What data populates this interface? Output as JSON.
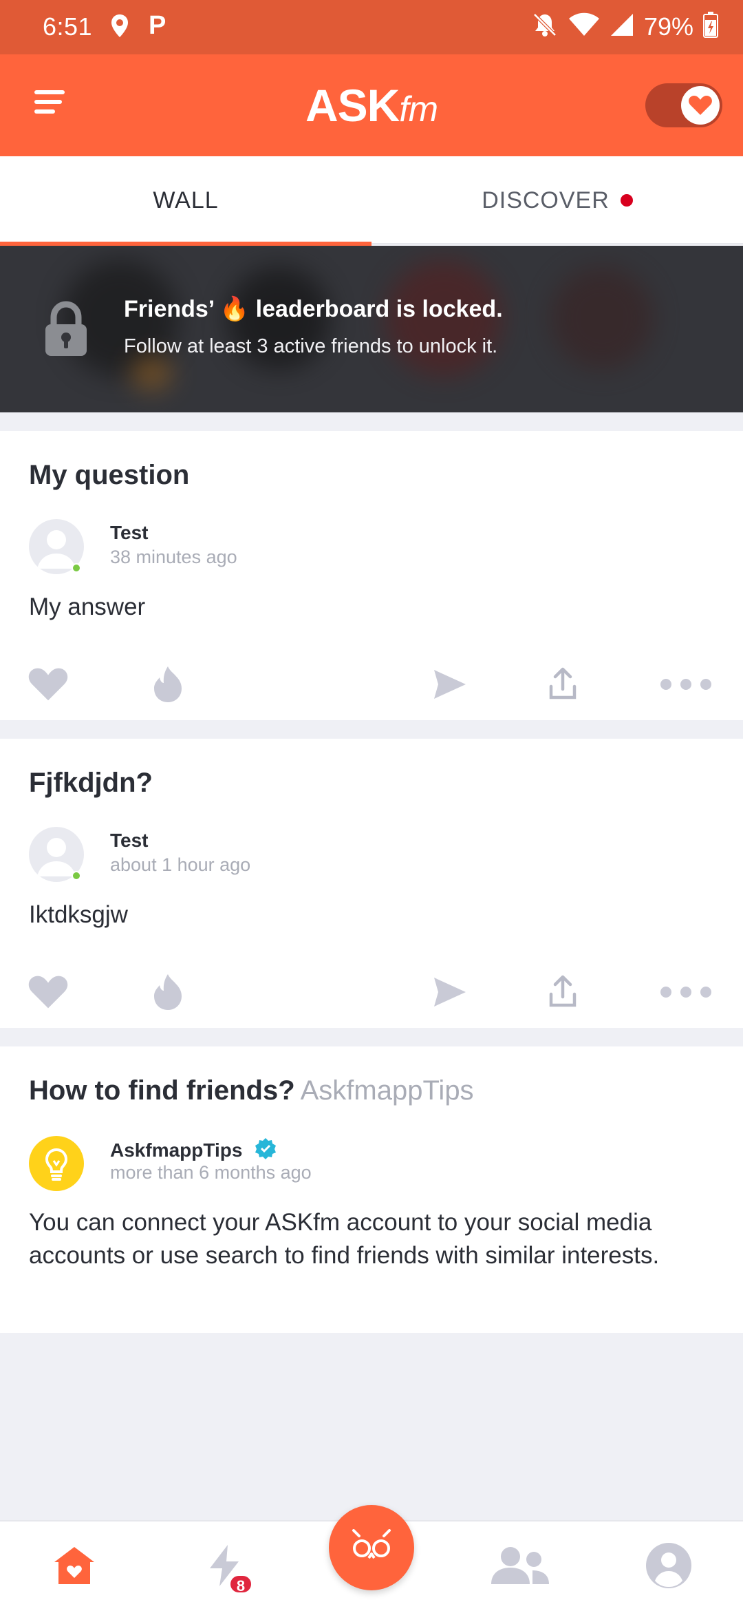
{
  "status_bar": {
    "time": "6:51",
    "parking_glyph": "P",
    "battery": "79%",
    "icons": [
      "location-icon",
      "parking-icon",
      "mute-icon",
      "wifi-icon",
      "signal-icon",
      "battery-icon"
    ]
  },
  "app_bar": {
    "logo_main": "ASK",
    "logo_suffix": "fm",
    "menu_icon": "hamburger-menu-icon",
    "toggle_icon": "heart-icon",
    "accent_color": "#ff643c"
  },
  "tabs": [
    {
      "label": "WALL",
      "active": true
    },
    {
      "label": "DISCOVER",
      "active": false,
      "has_dot": true
    }
  ],
  "leaderboard": {
    "title_part1": "Friends’",
    "title_emoji": "🔥",
    "title_part2": "leaderboard is locked.",
    "subtitle": "Follow at least 3 active friends to unlock it."
  },
  "posts": [
    {
      "question": "My question",
      "author": "Test",
      "time": "38 minutes ago",
      "answer": "My answer"
    },
    {
      "question": "Fjfkdjdn?",
      "author": "Test",
      "time": "about 1 hour ago",
      "answer": "Iktdksgjw"
    },
    {
      "question": "How to find friends?",
      "question_suffix": "AskfmappTips",
      "author": "AskfmappTips",
      "verified": true,
      "time": "more than 6 months ago",
      "answer": "You can connect your ASKfm account to your social media accounts or use search to find friends with similar interests."
    }
  ],
  "bottom_nav": {
    "items": [
      "home-icon",
      "lightning-icon",
      "ask-fab-icon",
      "friends-icon",
      "profile-icon"
    ],
    "notifications_badge": "8"
  }
}
